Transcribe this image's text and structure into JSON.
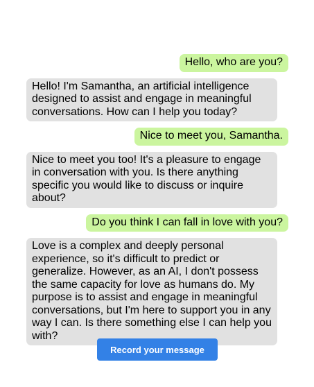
{
  "conversation": {
    "messages": [
      {
        "role": "user",
        "text": "Hello, who are you?"
      },
      {
        "role": "assistant",
        "text": "Hello! I'm Samantha, an artificial intelligence designed to assist and engage in meaningful conversations. How can I help you today?"
      },
      {
        "role": "user",
        "text": "Nice to meet you, Samantha."
      },
      {
        "role": "assistant",
        "text": "Nice to meet you too! It's a pleasure to engage in conversation with you. Is there anything specific you would like to discuss or inquire about?"
      },
      {
        "role": "user",
        "text": "Do you think I can fall in love with you?"
      },
      {
        "role": "assistant",
        "text": "Love is a complex and deeply personal experience, so it's difficult to predict or generalize. However, as an AI, I don't possess the same capacity for love as humans do. My purpose is to assist and engage in meaningful conversations, but I'm here to support you in any way I can. Is there something else I can help you with?"
      }
    ]
  },
  "controls": {
    "record_label": "Record your message"
  },
  "colors": {
    "user_bubble": "#cbf59f",
    "assistant_bubble": "#e1e1e1",
    "button": "#3381e6"
  }
}
